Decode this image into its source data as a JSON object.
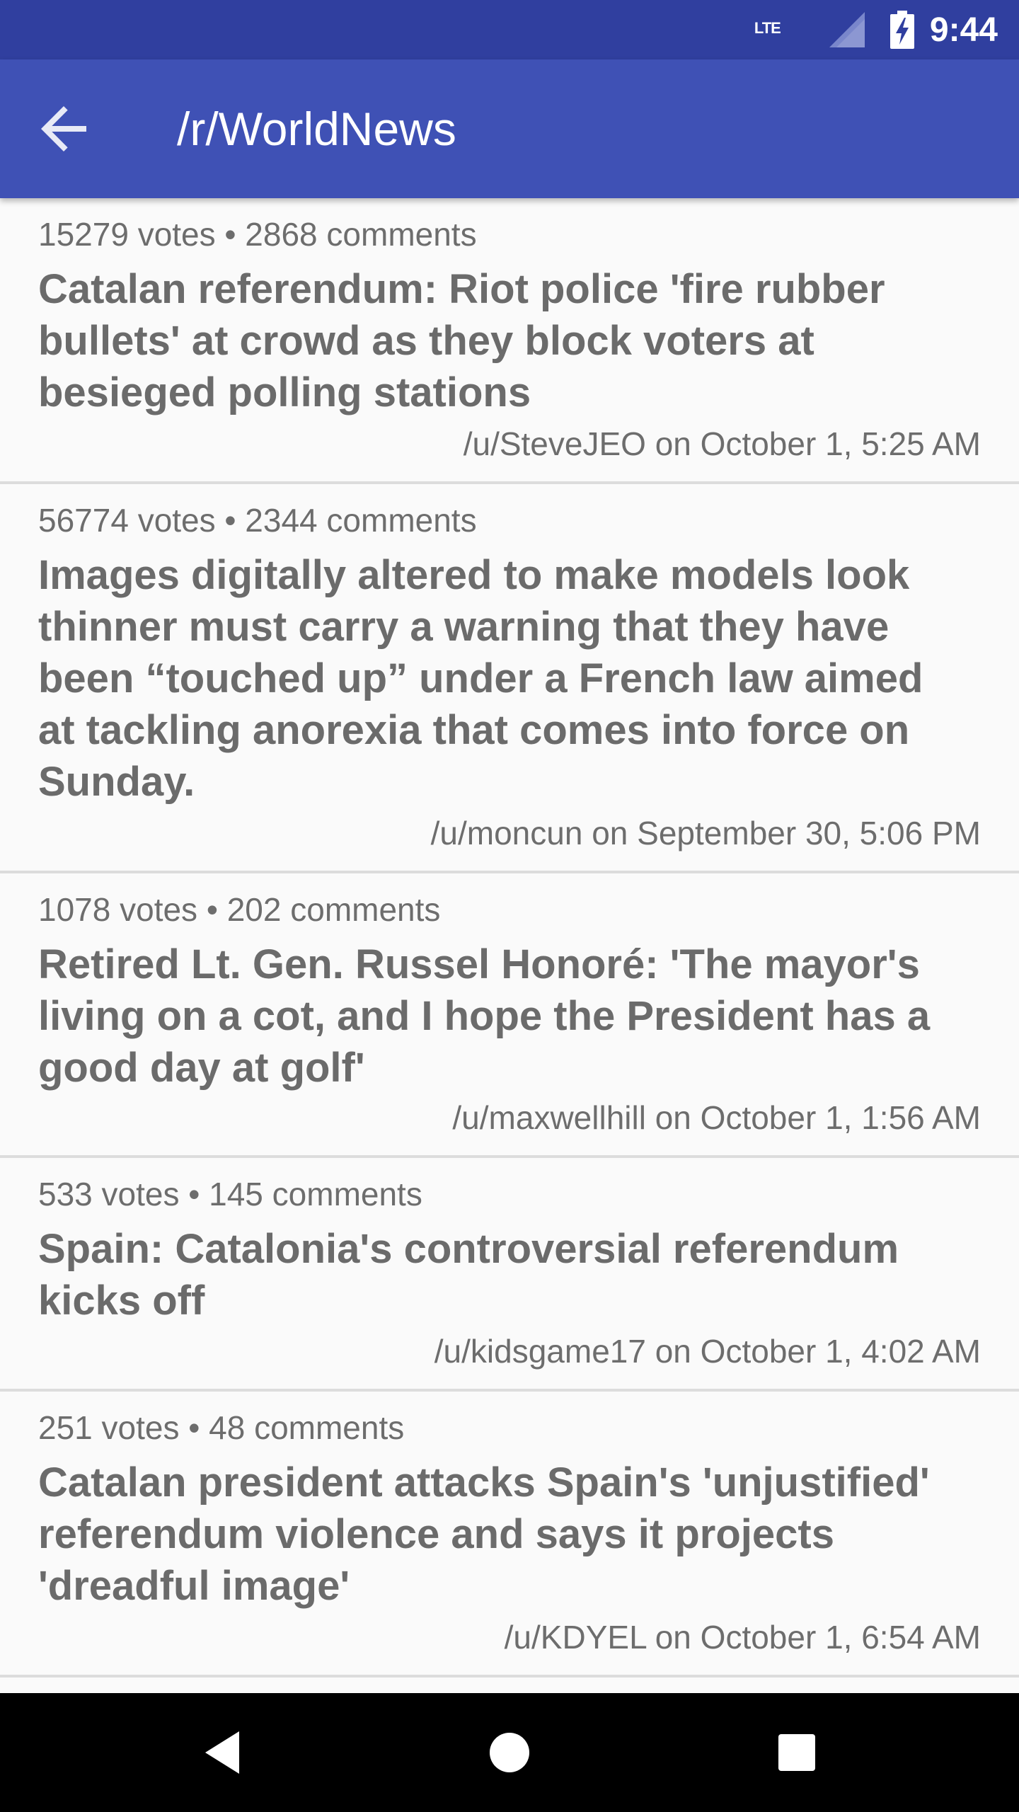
{
  "status_bar": {
    "network_label": "LTE",
    "time": "9:44"
  },
  "app_bar": {
    "title": "/r/WorldNews",
    "back_icon": "arrow-back-icon"
  },
  "posts": [
    {
      "meta": "15279 votes • 2868 comments",
      "title": "Catalan referendum: Riot police 'fire rubber bullets' at crowd as they block voters at besieged polling stations",
      "author": "/u/SteveJEO on October 1, 5:25 AM"
    },
    {
      "meta": "56774 votes • 2344 comments",
      "title": "Images digitally altered to make models look thinner must carry a warning that they have been “touched up” under a French law aimed at tackling anorexia that comes into force on Sunday.",
      "author": "/u/moncun on September 30, 5:06 PM"
    },
    {
      "meta": "1078 votes • 202 comments",
      "title": "Retired Lt. Gen. Russel Honoré: 'The mayor's living on a cot, and I hope the President has a good day at golf'",
      "author": "/u/maxwellhill on October 1, 1:56 AM"
    },
    {
      "meta": "533 votes • 145 comments",
      "title": "Spain: Catalonia's controversial referendum kicks off",
      "author": "/u/kidsgame17 on October 1, 4:02 AM"
    },
    {
      "meta": "251 votes • 48 comments",
      "title": "Catalan president attacks Spain's 'unjustified' referendum violence and says it projects 'dreadful image'",
      "author": "/u/KDYEL on October 1, 6:54 AM"
    }
  ],
  "nav_bar": {
    "back_icon": "nav-back-triangle-icon",
    "home_icon": "nav-home-circle-icon",
    "recents_icon": "nav-recents-square-icon"
  },
  "colors": {
    "status_bar": "#303f9f",
    "app_bar": "#3f51b5",
    "background": "#fafafa",
    "text": "#6b6b6b"
  }
}
